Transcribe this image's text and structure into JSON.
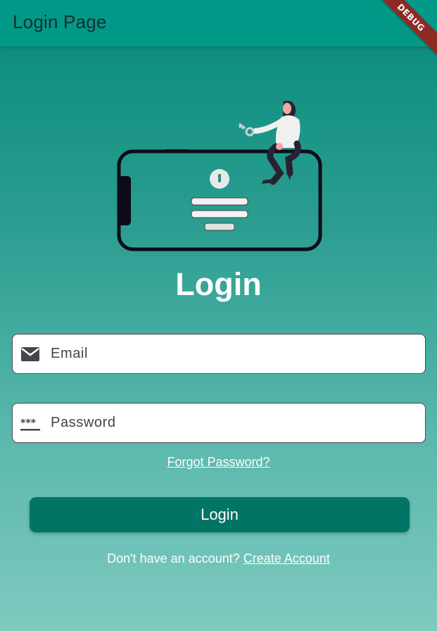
{
  "appbar": {
    "title": "Login Page",
    "debug_banner": "DEBUG"
  },
  "heading": "Login",
  "email_field": {
    "placeholder": "Email",
    "value": "",
    "icon": "mail-icon"
  },
  "password_field": {
    "placeholder": "Password",
    "value": "",
    "icon": "password-icon"
  },
  "forgot_password": "Forgot Password?",
  "login_button": "Login",
  "signup": {
    "prompt": "Don't have an account?",
    "link": "Create Account"
  },
  "colors": {
    "appbar": "#009886",
    "button": "#007565",
    "background_top": "#068a7a",
    "background_bottom": "#7ecabf",
    "debug_ribbon": "#8c2a23"
  }
}
